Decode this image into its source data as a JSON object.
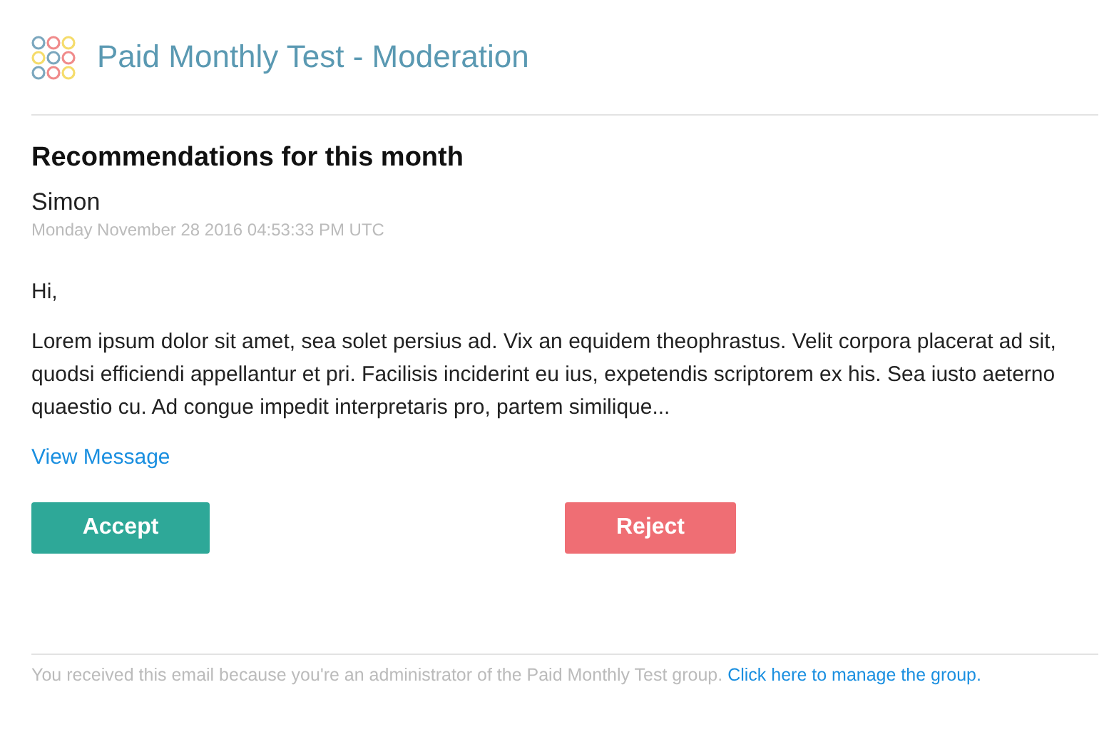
{
  "header": {
    "title": "Paid Monthly Test - Moderation"
  },
  "message": {
    "heading": "Recommendations for this month",
    "author": "Simon",
    "date": "Monday November 28 2016 04:53:33 PM UTC",
    "greeting": "Hi,",
    "body": "Lorem ipsum dolor sit amet, sea solet persius ad. Vix an equidem theophrastus. Velit corpora placerat ad sit, quodsi efficiendi appellantur et pri. Facilisis inciderint eu ius, expetendis scriptorem ex his. Sea iusto aeterno quaestio cu. Ad congue impedit interpretaris pro, partem similique...",
    "link": "View Message"
  },
  "buttons": [
    {
      "label": "Accept",
      "kind": "accept"
    },
    {
      "label": "Reject",
      "kind": "reject"
    }
  ],
  "footer": {
    "text": "You received this email because you're an administrator of the Paid Monthly Test group.",
    "link": "Click here to manage the group."
  }
}
